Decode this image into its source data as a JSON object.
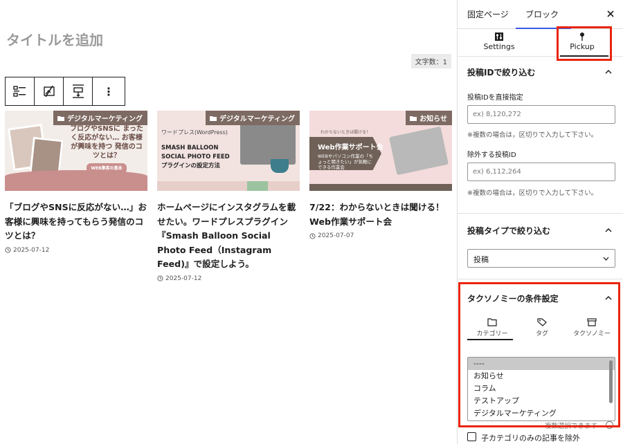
{
  "editor": {
    "post_title_placeholder": "タイトルを追加",
    "char_count": "文字数：1",
    "toolbar": {
      "icons": [
        "list-view-icon",
        "no-image-icon",
        "align-vertical-icon",
        "more-options-icon"
      ],
      "more_label": "⋮"
    },
    "cards": [
      {
        "category": "デジタルマーケティング",
        "thumb": {
          "text": "ブログやSNSに まったく反応がない… お客様が興味を持つ 発信のコツとは？",
          "pill": "WEB集客の基本"
        },
        "title": "「ブログやSNSに反応がない…」お客様に興味を持ってもらう発信のコツとは？",
        "date": "2025-07-12"
      },
      {
        "category": "デジタルマーケティング",
        "thumb": {
          "label": "ワードプレス(WordPress)",
          "title": "SMASH BALLOON SOCIAL PHOTO FEED プラグインの設定方法"
        },
        "title": "ホームページにインスタグラムを載せたい。ワードプレスプラグイン『Smash Balloon Social Photo Feed（Instagram Feed)』で設定しよう。",
        "date": "2025-07-12"
      },
      {
        "category": "お知らせ",
        "thumb": {
          "top": "わからないときは聞ける！",
          "big": "Web作業サポート会",
          "sub": "WEBやパソコン作業の「ちょっと聞きたい」が気軽にできる作業会"
        },
        "title": "7/22：わからないときは聞ける！Web作業サポート会",
        "date": "2025-07-07"
      }
    ]
  },
  "sidebar": {
    "tabs": [
      "固定ページ",
      "ブロック"
    ],
    "active_tab": "ブロック",
    "close_label": "×",
    "subtabs": {
      "settings": "Settings",
      "pickup": "Pickup"
    },
    "post_id_panel": {
      "title": "投稿IDで絞り込む",
      "direct_label": "投稿IDを直接指定",
      "direct_placeholder": "ex) 8,120,272",
      "direct_help": "※複数の場合は，区切りで入力して下さい。",
      "exclude_label": "除外する投稿ID",
      "exclude_placeholder": "ex) 6,112,264",
      "exclude_help": "※複数の場合は，区切りで入力して下さい。"
    },
    "post_type_panel": {
      "title": "投稿タイプで絞り込む",
      "selected": "投稿"
    },
    "taxonomy_panel": {
      "title": "タクソノミーの条件設定",
      "tabs": [
        "カテゴリー",
        "タグ",
        "タクソノミー"
      ],
      "options": [
        "----",
        "お知らせ",
        "コラム",
        "テストアップ",
        "デジタルマーケティング"
      ],
      "selected_option": "----",
      "multi_help": "複数選択できます"
    },
    "exclude_child_label": "子カテゴリのみの記事を除外"
  },
  "colors": {
    "highlight": "#e8250e",
    "badge": "#7d6a62",
    "wp_blue": "#3858e9"
  }
}
